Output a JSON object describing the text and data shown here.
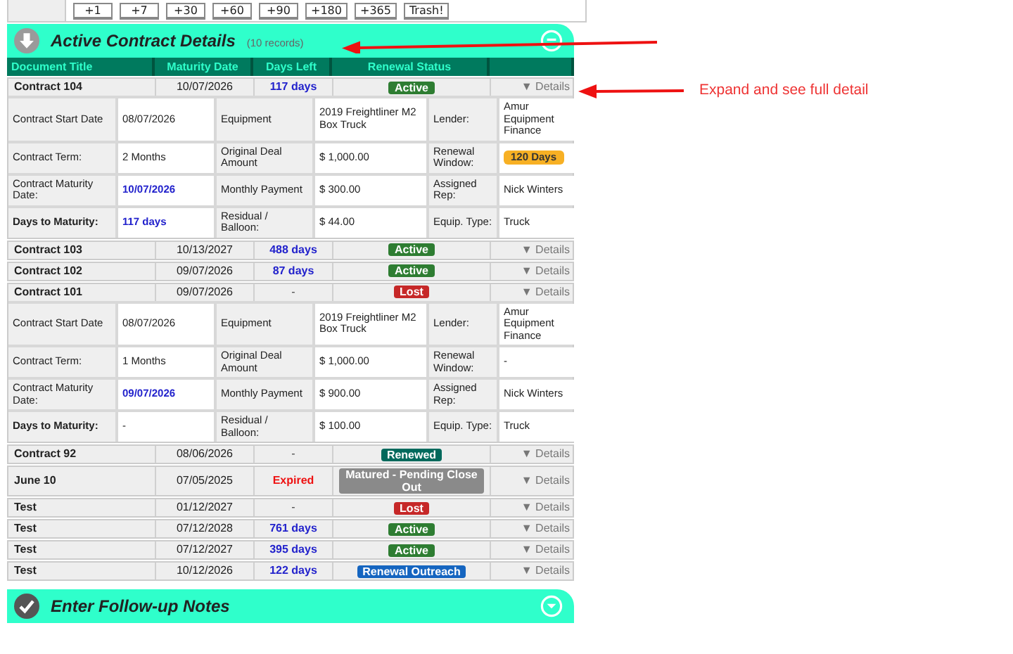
{
  "quick_buttons": [
    "+1",
    "+7",
    "+30",
    "+60",
    "+90",
    "+180",
    "+365",
    "Trash!"
  ],
  "section": {
    "title": "Active Contract Details",
    "count": "(10 records)",
    "expanded": true
  },
  "columns": [
    "Document Title",
    "Maturity Date",
    "Days Left",
    "Renewal Status",
    ""
  ],
  "rows": [
    {
      "title": "Contract 104",
      "maturity": "10/07/2026",
      "days_left": {
        "text": "117 days",
        "kind": "days"
      },
      "status": {
        "text": "Active",
        "color": "#2e7d32"
      },
      "details_link": "▼ Details",
      "details": [
        [
          {
            "text": "Contract Start Date",
            "kind": "label"
          },
          {
            "text": "08/07/2026",
            "kind": "value"
          },
          {
            "text": "Equipment",
            "kind": "label"
          },
          {
            "text": "2019 Freightliner M2 Box Truck",
            "kind": "value"
          },
          {
            "text": "Lender:",
            "kind": "label"
          },
          {
            "text": "Amur Equipment Finance",
            "kind": "value"
          }
        ],
        [
          {
            "text": "Contract Term:",
            "kind": "label"
          },
          {
            "text": "2 Months",
            "kind": "value"
          },
          {
            "text": "Original Deal Amount",
            "kind": "label"
          },
          {
            "text": "$ 1,000.00",
            "kind": "value"
          },
          {
            "text": "Renewal Window:",
            "kind": "label"
          },
          {
            "text": "120 Days",
            "kind": "badge"
          }
        ],
        [
          {
            "text": "Contract Maturity Date:",
            "kind": "label"
          },
          {
            "text": "10/07/2026",
            "kind": "date"
          },
          {
            "text": "Monthly Payment",
            "kind": "label"
          },
          {
            "text": "$ 300.00",
            "kind": "value"
          },
          {
            "text": "Assigned Rep:",
            "kind": "label"
          },
          {
            "text": "Nick Winters",
            "kind": "value"
          }
        ],
        [
          {
            "text": "Days to Maturity:",
            "kind": "strong"
          },
          {
            "text": "117 days",
            "kind": "date"
          },
          {
            "text": "Residual / Balloon:",
            "kind": "label"
          },
          {
            "text": "$ 44.00",
            "kind": "value"
          },
          {
            "text": "Equip. Type:",
            "kind": "label"
          },
          {
            "text": "Truck",
            "kind": "value"
          }
        ]
      ]
    },
    {
      "title": "Contract 103",
      "maturity": "10/13/2027",
      "days_left": {
        "text": "488 days",
        "kind": "days"
      },
      "status": {
        "text": "Active",
        "color": "#2e7d32"
      },
      "details_link": "▼ Details"
    },
    {
      "title": "Contract 102",
      "maturity": "09/07/2026",
      "days_left": {
        "text": "87 days",
        "kind": "days"
      },
      "status": {
        "text": "Active",
        "color": "#2e7d32"
      },
      "details_link": "▼ Details"
    },
    {
      "title": "Contract 101",
      "maturity": "09/07/2026",
      "days_left": {
        "text": "-",
        "kind": "none"
      },
      "status": {
        "text": "Lost",
        "color": "#c62828"
      },
      "details_link": "▼ Details",
      "details": [
        [
          {
            "text": "Contract Start Date",
            "kind": "label"
          },
          {
            "text": "08/07/2026",
            "kind": "value"
          },
          {
            "text": "Equipment",
            "kind": "label"
          },
          {
            "text": "2019 Freightliner M2 Box Truck",
            "kind": "value"
          },
          {
            "text": "Lender:",
            "kind": "label"
          },
          {
            "text": "Amur Equipment Finance",
            "kind": "value"
          }
        ],
        [
          {
            "text": "Contract Term:",
            "kind": "label"
          },
          {
            "text": "1 Months",
            "kind": "value"
          },
          {
            "text": "Original Deal Amount",
            "kind": "label"
          },
          {
            "text": "$ 1,000.00",
            "kind": "value"
          },
          {
            "text": "Renewal Window:",
            "kind": "label"
          },
          {
            "text": "-",
            "kind": "value"
          }
        ],
        [
          {
            "text": "Contract Maturity Date:",
            "kind": "label"
          },
          {
            "text": "09/07/2026",
            "kind": "date"
          },
          {
            "text": "Monthly Payment",
            "kind": "label"
          },
          {
            "text": "$ 900.00",
            "kind": "value"
          },
          {
            "text": "Assigned Rep:",
            "kind": "label"
          },
          {
            "text": "Nick Winters",
            "kind": "value"
          }
        ],
        [
          {
            "text": "Days to Maturity:",
            "kind": "strong"
          },
          {
            "text": "-",
            "kind": "value"
          },
          {
            "text": "Residual / Balloon:",
            "kind": "label"
          },
          {
            "text": "$ 100.00",
            "kind": "value"
          },
          {
            "text": "Equip. Type:",
            "kind": "label"
          },
          {
            "text": "Truck",
            "kind": "value"
          }
        ]
      ]
    },
    {
      "title": "Contract 92",
      "maturity": "08/06/2026",
      "days_left": {
        "text": "-",
        "kind": "none"
      },
      "status": {
        "text": "Renewed",
        "color": "#00695c"
      },
      "details_link": "▼ Details"
    },
    {
      "title": "June 10",
      "maturity": "07/05/2025",
      "days_left": {
        "text": "Expired",
        "kind": "expired"
      },
      "status": {
        "text": "Matured - Pending Close Out",
        "color": "#8a8a8a"
      },
      "details_link": "▼ Details"
    },
    {
      "title": "Test",
      "maturity": "01/12/2027",
      "days_left": {
        "text": "-",
        "kind": "none"
      },
      "status": {
        "text": "Lost",
        "color": "#c62828"
      },
      "details_link": "▼ Details"
    },
    {
      "title": "Test",
      "maturity": "07/12/2028",
      "days_left": {
        "text": "761 days",
        "kind": "days"
      },
      "status": {
        "text": "Active",
        "color": "#2e7d32"
      },
      "details_link": "▼ Details"
    },
    {
      "title": "Test",
      "maturity": "07/12/2027",
      "days_left": {
        "text": "395 days",
        "kind": "days"
      },
      "status": {
        "text": "Active",
        "color": "#2e7d32"
      },
      "details_link": "▼ Details"
    },
    {
      "title": "Test",
      "maturity": "10/12/2026",
      "days_left": {
        "text": "122 days",
        "kind": "days"
      },
      "status": {
        "text": "Renewal Outreach",
        "color": "#1565c0"
      },
      "details_link": "▼ Details"
    }
  ],
  "notes_section": {
    "title": "Enter Follow-up Notes",
    "expanded": false
  },
  "annotation": {
    "text": "Expand and see full detail"
  }
}
